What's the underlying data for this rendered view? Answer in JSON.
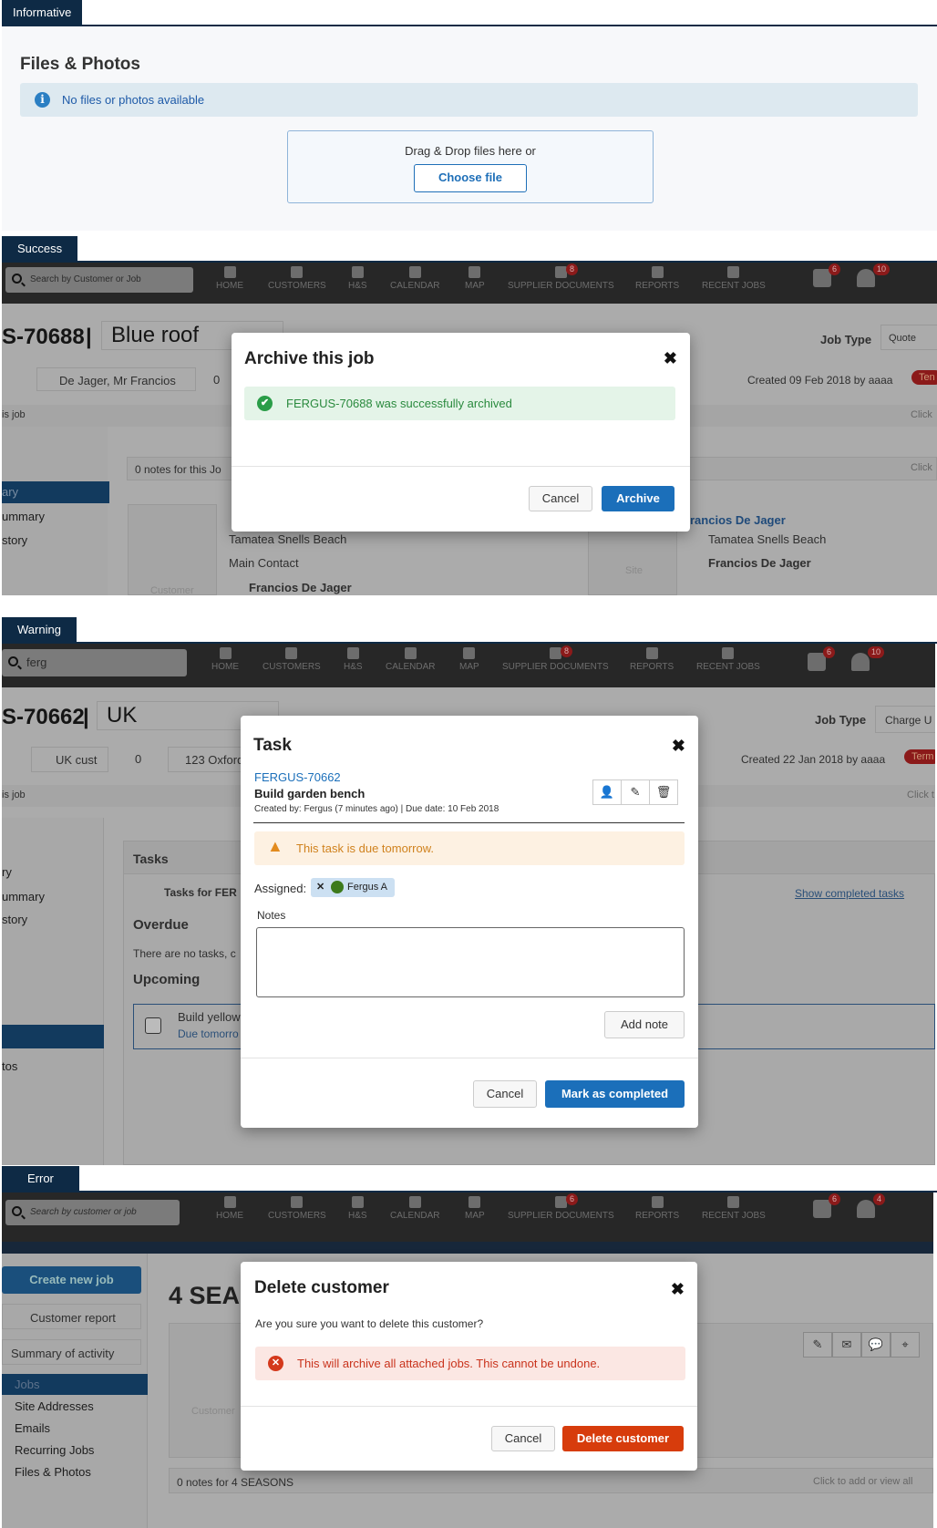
{
  "sections": {
    "informative": "Informative",
    "success": "Success",
    "warning": "Warning",
    "error": "Error"
  },
  "files": {
    "title": "Files & Photos",
    "info": "No files or photos available",
    "drop_label": "Drag & Drop files here or",
    "choose_button": "Choose file"
  },
  "nav": {
    "items": [
      "HOME",
      "CUSTOMERS",
      "H&S",
      "CALENDAR",
      "MAP",
      "SUPPLIER DOCUMENTS",
      "REPORTS",
      "RECENT JOBS"
    ]
  },
  "success_bg": {
    "search_placeholder": "Search by Customer or Job",
    "supplier_badge": "8",
    "tasks_badge": "6",
    "bell_badge": "10",
    "job_id": "S-70688",
    "job_name": "Blue roof",
    "job_type_label": "Job Type",
    "job_type_value": "Quote",
    "customer": "De Jager, Mr Francios",
    "count": "0",
    "created": "Created 09 Feb 2018 by aaaa",
    "status_tag": "Ten",
    "bar_text": "is job",
    "click_text": "Click",
    "notes": "0 notes for this Jo",
    "side": [
      "ary",
      "ummary",
      "story"
    ],
    "address": "Tamatea Snells Beach",
    "main_contact": "Main Contact",
    "contact_name": "Francios De Jager",
    "customer_label": "Customer",
    "site_label": "Site",
    "site_link": "rancios De Jager",
    "site_address": "Tamatea Snells Beach",
    "site_contact": "Francios De Jager"
  },
  "archive_modal": {
    "title": "Archive this job",
    "message": "FERGUS-70688 was successfully archived",
    "cancel": "Cancel",
    "archive": "Archive"
  },
  "warning_bg": {
    "search_value": "ferg",
    "supplier_badge": "8",
    "tasks_badge": "6",
    "bell_badge": "10",
    "job_id": "S-70662",
    "job_name": "UK",
    "job_type_label": "Job Type",
    "job_type_value": "Charge U",
    "customer": "UK cust",
    "count": "0",
    "address": "123 Oxford",
    "created": "Created 22 Jan 2018 by aaaa",
    "status_tag": "Term",
    "bar_text": "is job",
    "click_text": "Click t",
    "tasks_header": "Tasks",
    "tasks_for": "Tasks for FER",
    "show_completed": "Show completed tasks",
    "overdue": "Overdue",
    "no_tasks": "There are no tasks, c",
    "upcoming": "Upcoming",
    "task_name": "Build yellow",
    "task_due": "Due tomorro",
    "side": [
      "ry",
      "ummary",
      "story",
      "tos"
    ]
  },
  "task_modal": {
    "title": "Task",
    "job_link": "FERGUS-70662",
    "task_name": "Build garden bench",
    "meta": "Created  by: Fergus (7 minutes ago) | Due date: 10 Feb 2018",
    "warning": "This task is due tomorrow.",
    "assigned_label": "Assigned:",
    "assignee": "Fergus A",
    "notes_label": "Notes",
    "notes_value": "",
    "add_note": "Add note",
    "cancel": "Cancel",
    "complete": "Mark as completed"
  },
  "error_bg": {
    "search_placeholder": "Search by customer or job",
    "supplier_badge": "6",
    "tasks_badge": "6",
    "bell_badge": "4",
    "create_job": "Create new job",
    "customer_report": "Customer report",
    "summary": "Summary of activity",
    "side": [
      "Jobs",
      "Site Addresses",
      "Emails",
      "Recurring Jobs",
      "Files & Photos"
    ],
    "heading": "4 SEA",
    "customer_label": "Customer",
    "notes": "0 notes for 4 SEASONS",
    "click_text": "Click to add or view all"
  },
  "delete_modal": {
    "title": "Delete customer",
    "question": "Are you sure you want to delete this customer?",
    "message": "This will archive all attached jobs. This cannot be undone.",
    "cancel": "Cancel",
    "delete": "Delete customer"
  },
  "colors": {
    "primary": "#1b6fba",
    "danger": "#d73c0c",
    "success_bg": "#e4f4e8",
    "success_text": "#2a8a3e",
    "warning_bg": "#fdf1e2",
    "warning_text": "#d0821e",
    "error_bg": "#fbe7e3",
    "error_text": "#c9331c",
    "info_bg": "#dde9f0",
    "nav_dark": "#0e2a45"
  }
}
